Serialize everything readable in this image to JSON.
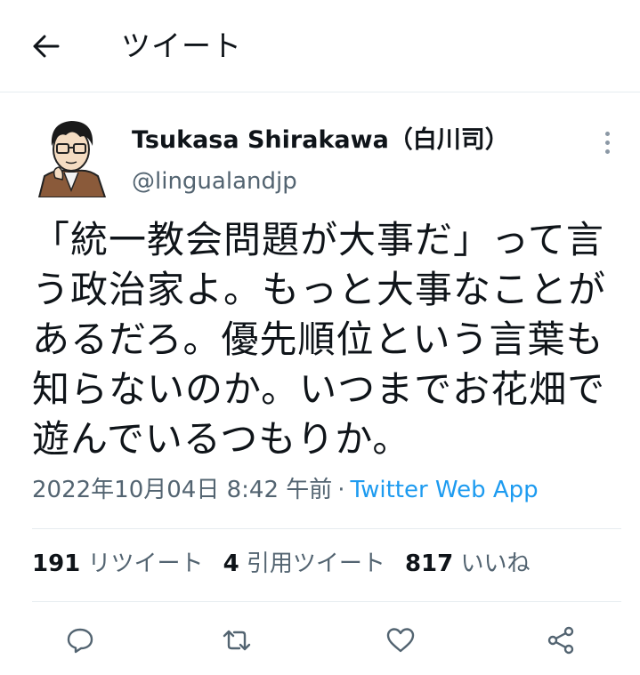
{
  "header": {
    "title": "ツイート",
    "back_icon": "arrow-left-icon"
  },
  "tweet": {
    "author": {
      "display_name": "Tsukasa Shirakawa（白川司）",
      "handle": "@lingualandjp",
      "avatar_icon": "cartoon-avatar"
    },
    "text_lines": [
      "「統一教会問題が大事だ」って言",
      "う政治家よ。もっと大事なことが",
      "あるだろ。優先順位という言葉も",
      "知らないのか。いつまでお花畑で",
      "遊んでいるつもりか。"
    ],
    "timestamp": "2022年10月04日 8:42 午前",
    "separator": "·",
    "source": "Twitter Web App"
  },
  "stats": {
    "retweets": {
      "count": "191",
      "label": "リツイート"
    },
    "quotes": {
      "count": "4",
      "label": "引用ツイート"
    },
    "likes": {
      "count": "817",
      "label": "いいね"
    }
  },
  "actions": [
    "reply-icon",
    "retweet-icon",
    "like-icon",
    "share-icon"
  ],
  "colors": {
    "link": "#1d9bf0",
    "secondary": "#536471",
    "border": "#e6ecf0"
  }
}
